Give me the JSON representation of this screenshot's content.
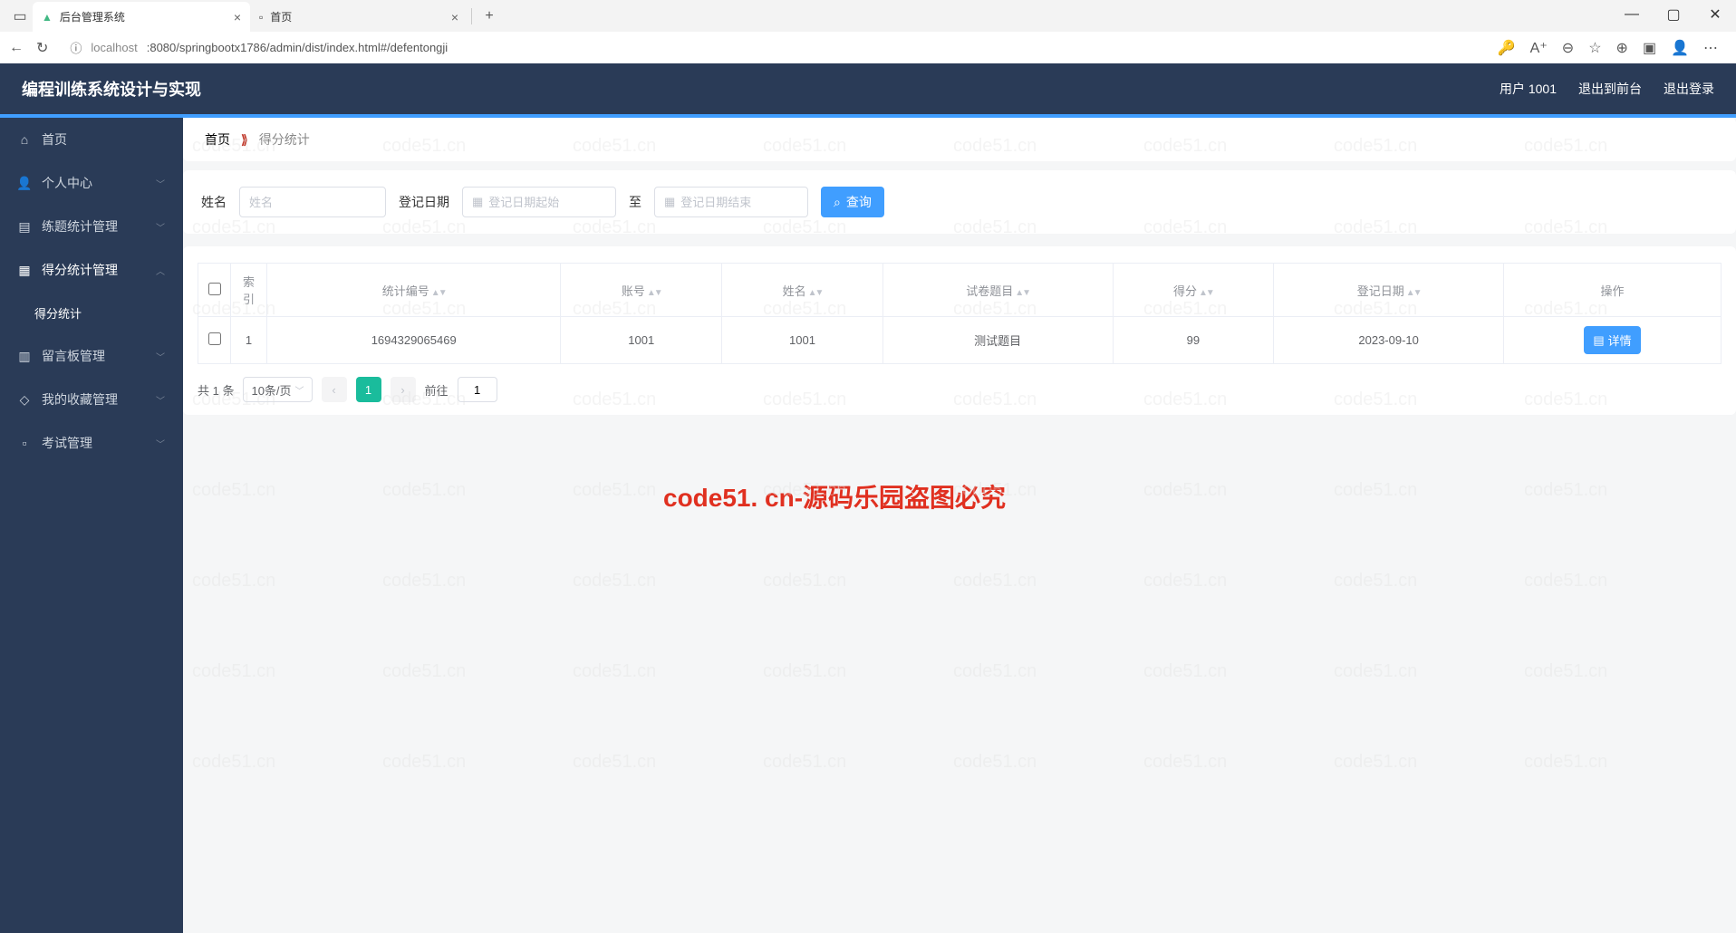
{
  "browser": {
    "tab1_title": "后台管理系统",
    "tab2_title": "首页",
    "url_host": "localhost",
    "url_path": ":8080/springbootx1786/admin/dist/index.html#/defentongji"
  },
  "header": {
    "app_title": "编程训练系统设计与实现",
    "user_label": "用户 1001",
    "to_front": "退出到前台",
    "logout": "退出登录"
  },
  "sidebar": {
    "home": "首页",
    "personal": "个人中心",
    "practice_stats": "练题统计管理",
    "score_stats": "得分统计管理",
    "score_sub": "得分统计",
    "message_board": "留言板管理",
    "favorites": "我的收藏管理",
    "exam": "考试管理"
  },
  "crumb": {
    "home": "首页",
    "current": "得分统计"
  },
  "filter": {
    "name_label": "姓名",
    "name_placeholder": "姓名",
    "date_label": "登记日期",
    "date_start_placeholder": "登记日期起始",
    "date_end_placeholder": "登记日期结束",
    "range_to": "至",
    "search_btn": "查询"
  },
  "table": {
    "cols": {
      "index": "索引",
      "stat_id": "统计编号",
      "account": "账号",
      "name": "姓名",
      "exam_title": "试卷题目",
      "score": "得分",
      "reg_date": "登记日期",
      "ops": "操作"
    },
    "rows": [
      {
        "index": "1",
        "stat_id": "1694329065469",
        "account": "1001",
        "name": "1001",
        "exam_title": "测试题目",
        "score": "99",
        "reg_date": "2023-09-10"
      }
    ],
    "detail_btn": "详情"
  },
  "pagination": {
    "total": "共 1 条",
    "page_size": "10条/页",
    "current_page": "1",
    "goto_label": "前往"
  },
  "watermark": "code51.cn",
  "big_watermark": "code51. cn-源码乐园盗图必究"
}
